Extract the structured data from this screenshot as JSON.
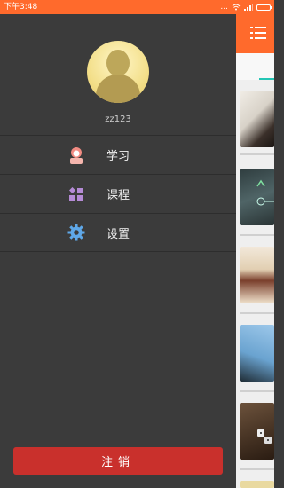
{
  "status_bar": {
    "time": "下午3:48",
    "dots": "...",
    "signal_text": "ᯤ"
  },
  "drawer": {
    "username": "zz123",
    "menu": [
      {
        "label": "学习",
        "icon": "study-person-icon"
      },
      {
        "label": "课程",
        "icon": "course-grid-icon"
      },
      {
        "label": "设置",
        "icon": "settings-gear-icon"
      }
    ],
    "logout_label": "注销"
  },
  "background_app": {
    "accent": "#ff6a2c",
    "tab_indicator_color": "#24c6b5",
    "thumbnails": [
      {
        "name": "thumb-hands-papers",
        "colors": [
          "#e9e3da",
          "#2a2320"
        ]
      },
      {
        "name": "thumb-dark-screen",
        "colors": [
          "#3a4d4e",
          "#6d8a88"
        ]
      },
      {
        "name": "thumb-toys",
        "colors": [
          "#e8d9c4",
          "#6b3b2c"
        ]
      },
      {
        "name": "thumb-sky-dark",
        "colors": [
          "#7fb3dc",
          "#1d2a33"
        ]
      },
      {
        "name": "thumb-wood-dice",
        "colors": [
          "#5a4534",
          "#2a1c12"
        ]
      }
    ]
  },
  "colors": {
    "drawer_bg": "#3b3b3b",
    "logout_bg": "#c9302c",
    "status_bar": "#ff6a2c"
  }
}
